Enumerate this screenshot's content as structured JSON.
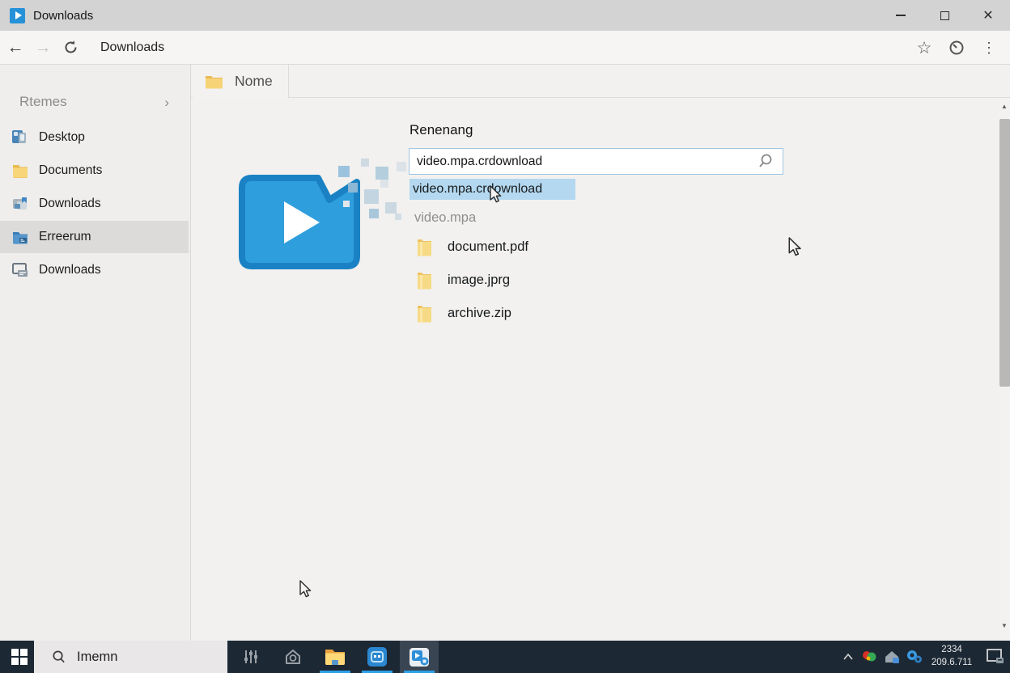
{
  "window": {
    "title": "Downloads"
  },
  "toolbar": {
    "address": "Downloads"
  },
  "sidebar": {
    "header": "Rtemes",
    "items": [
      {
        "label": "Desktop"
      },
      {
        "label": "Documents"
      },
      {
        "label": "Downloads"
      },
      {
        "label": "Erreerum"
      },
      {
        "label": "Downloads"
      }
    ]
  },
  "main": {
    "tab_label": "Nome",
    "rename_heading": "Renenang",
    "filename_input": "video.mpa.crdownload",
    "files": [
      {
        "name": "video.mpa.crdownload"
      },
      {
        "name": "video.mpa"
      },
      {
        "name": "document.pdf"
      },
      {
        "name": "image.jprg"
      },
      {
        "name": "archive.zip"
      }
    ]
  },
  "taskbar": {
    "search_text": "Imemn",
    "clock": {
      "time": "2334",
      "date": "209.6.711"
    }
  },
  "icons": {
    "close": "✕",
    "back": "←",
    "forward": "→",
    "star": "☆",
    "menu": "⋮",
    "sidebar_chevron": "›",
    "scroll_up": "▲",
    "scroll_down": "▼"
  },
  "colors": {
    "accent_blue": "#2f9edd",
    "accent_blue_border": "#1a82c4",
    "selection_highlight": "#b3d8ef",
    "input_border": "#9fc6e2",
    "taskbar_bg": "#1c2834",
    "folder_yellow": "#f5d679",
    "underline_blue": "#2b9fe8",
    "titlebar_bg": "#d3d3d3"
  }
}
